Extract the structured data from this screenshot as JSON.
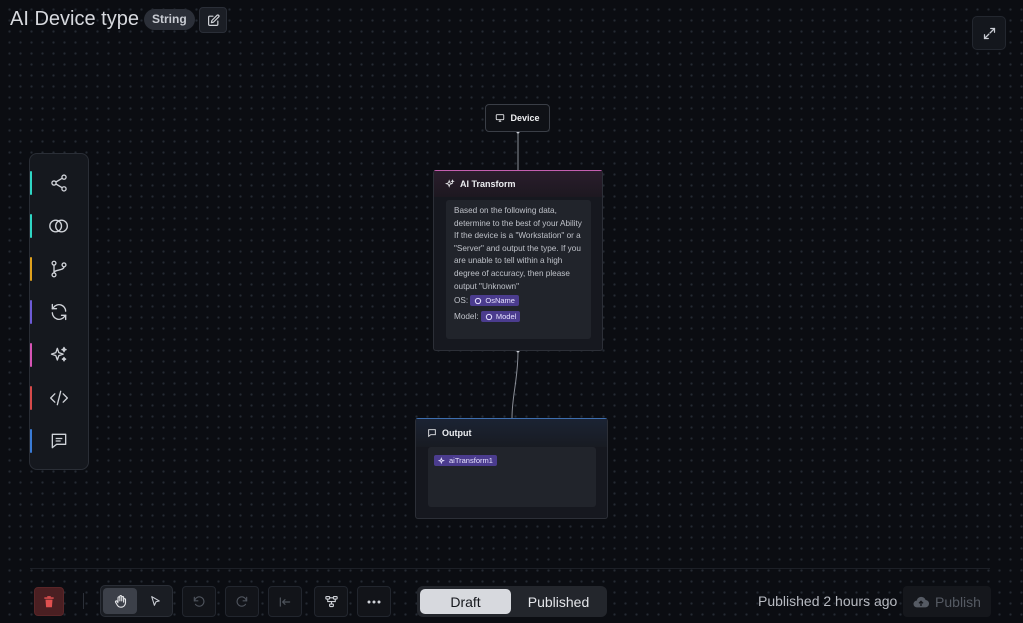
{
  "header": {
    "title": "AI Device type",
    "type_badge": "String"
  },
  "palette": {
    "items": [
      {
        "name": "graph-node-icon",
        "accent": "#2fd6c4"
      },
      {
        "name": "intersect-circles-icon",
        "accent": "#2fd6c4"
      },
      {
        "name": "git-branch-icon",
        "accent": "#e0a11d"
      },
      {
        "name": "refresh-icon",
        "accent": "#6d5bd6"
      },
      {
        "name": "sparkles-icon",
        "accent": "#d654b5"
      },
      {
        "name": "code-icon",
        "accent": "#d64a4a"
      },
      {
        "name": "message-icon",
        "accent": "#3a7bd5"
      }
    ]
  },
  "nodes": {
    "device": {
      "label": "Device"
    },
    "ai_transform": {
      "label": "AI Transform",
      "prompt": "Based on the following data, determine to the best of your Ability If the device is a \"Workstation\" or a \"Server\" and output the type. If you are unable to tell within a high degree of accuracy, then please output \"Unknown\"",
      "os_label": "OS:",
      "os_chip": "OsName",
      "model_label": "Model:",
      "model_chip": "Model"
    },
    "output": {
      "label": "Output",
      "chip": "aiTransform1"
    }
  },
  "toolbar": {
    "draft_label": "Draft",
    "published_label": "Published",
    "status": "Published 2 hours ago",
    "publish_label": "Publish"
  },
  "colors": {
    "ai_accent": "#c45fb0",
    "output_accent": "#3e6fb0",
    "chip_bg": "#4b3c8e"
  }
}
